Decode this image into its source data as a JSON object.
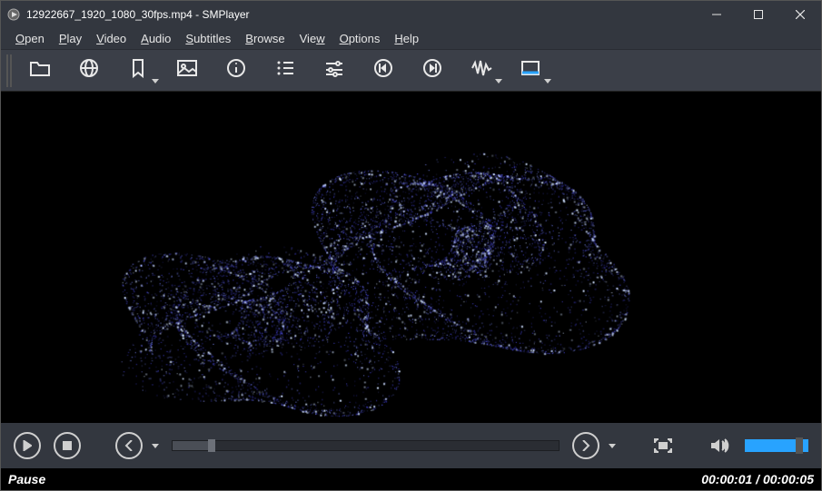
{
  "titlebar": {
    "title": "12922667_1920_1080_30fps.mp4 - SMPlayer"
  },
  "menus": {
    "open": {
      "pre": "",
      "u": "O",
      "post": "pen"
    },
    "play": {
      "pre": "",
      "u": "P",
      "post": "lay"
    },
    "video": {
      "pre": "",
      "u": "V",
      "post": "ideo"
    },
    "audio": {
      "pre": "",
      "u": "A",
      "post": "udio"
    },
    "subtitles": {
      "pre": "",
      "u": "S",
      "post": "ubtitles"
    },
    "browse": {
      "pre": "",
      "u": "B",
      "post": "rowse"
    },
    "view": {
      "pre": "Vie",
      "u": "w",
      "post": ""
    },
    "options": {
      "pre": "",
      "u": "O",
      "post": "ptions"
    },
    "help": {
      "pre": "",
      "u": "H",
      "post": "elp"
    }
  },
  "toolbar": {
    "items": [
      {
        "name": "open-file",
        "icon": "folder",
        "dropdown": false
      },
      {
        "name": "open-url",
        "icon": "globe",
        "dropdown": false
      },
      {
        "name": "favorites",
        "icon": "bookmark",
        "dropdown": true
      },
      {
        "name": "screenshot",
        "icon": "image",
        "dropdown": false
      },
      {
        "name": "file-info",
        "icon": "info",
        "dropdown": false
      },
      {
        "name": "playlist",
        "icon": "list",
        "dropdown": false
      },
      {
        "name": "preferences",
        "icon": "sliders",
        "dropdown": false
      },
      {
        "name": "prev-chapter",
        "icon": "skip-back",
        "dropdown": false
      },
      {
        "name": "next-chapter",
        "icon": "skip-fwd",
        "dropdown": false
      },
      {
        "name": "audio-equalizer",
        "icon": "wave",
        "dropdown": true
      },
      {
        "name": "video-equalizer",
        "icon": "screen",
        "dropdown": true
      }
    ]
  },
  "playback": {
    "position_pct": 10,
    "volume_pct": 85
  },
  "status": {
    "state": "Pause",
    "time": "00:00:01 / 00:00:05"
  }
}
